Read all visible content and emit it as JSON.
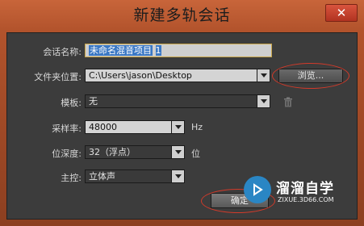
{
  "window": {
    "title": "新建多轨会话",
    "close_label": "✕"
  },
  "form": {
    "session_name": {
      "label": "会话名称:",
      "value": "未命名混音项目",
      "caret_suffix": "1"
    },
    "folder_location": {
      "label": "文件夹位置:",
      "value": "C:\\Users\\jason\\Desktop"
    },
    "template": {
      "label": "模板:",
      "value": "无"
    },
    "sample_rate": {
      "label": "采样率:",
      "value": "48000",
      "unit": "Hz"
    },
    "bit_depth": {
      "label": "位深度:",
      "value": "32（浮点）",
      "unit": "位"
    },
    "master": {
      "label": "主控:",
      "value": "立体声"
    }
  },
  "buttons": {
    "browse": "浏览...",
    "ok": "确定"
  },
  "watermark": {
    "name": "溜溜自学",
    "url": "ZIXUE.3D66.COM"
  },
  "colors": {
    "title_bar": "#b2532c",
    "panel": "#3c3c3c",
    "highlight": "#3b78c4",
    "annotation_oval": "#d23a2a"
  }
}
